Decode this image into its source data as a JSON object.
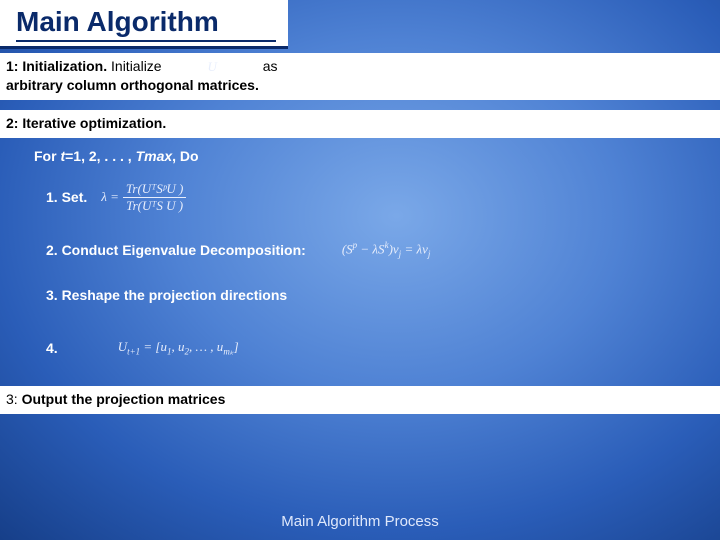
{
  "slide": {
    "title": "Main Algorithm",
    "step1": {
      "prefix": "1: Initialization.",
      "mid": " Initialize",
      "var": "U",
      "tail_a": "as",
      "line2": "arbitrary column orthogonal matrices."
    },
    "step2": {
      "heading": "2: Iterative optimization.",
      "for_prefix": "For ",
      "for_var": "t",
      "for_rest": "=1, 2, . . . , ",
      "for_tmax": "Tmax",
      "for_do": ", Do",
      "s1_label": "1. Set.",
      "s1_lambda": "λ =",
      "s1_num": "Tr(UᵀSᵖU )",
      "s1_den": "Tr(UᵀS U )",
      "s2_label": "2. Conduct Eigenvalue Decomposition:",
      "s2_eq_a": "(S",
      "s2_eq_p": "p",
      "s2_eq_b": " − λS",
      "s2_eq_k": "k",
      "s2_eq_c": ")ν",
      "s2_eq_j": "j",
      "s2_eq_d": " = λν",
      "s2_eq_j2": "j",
      "s3_label": "3. Reshape the projection directions",
      "s4_label": "4.",
      "s4_eq_a": "U",
      "s4_eq_t1": "t+1",
      "s4_eq_b": " = [u",
      "s4_eq_1": "1",
      "s4_eq_c": ", u",
      "s4_eq_2": "2",
      "s4_eq_d": ", … , u",
      "s4_eq_m": "mₖ",
      "s4_eq_e": "]"
    },
    "step3": {
      "prefix": "3: ",
      "text": "Output the projection matrices"
    },
    "footer": "Main Algorithm Process"
  }
}
